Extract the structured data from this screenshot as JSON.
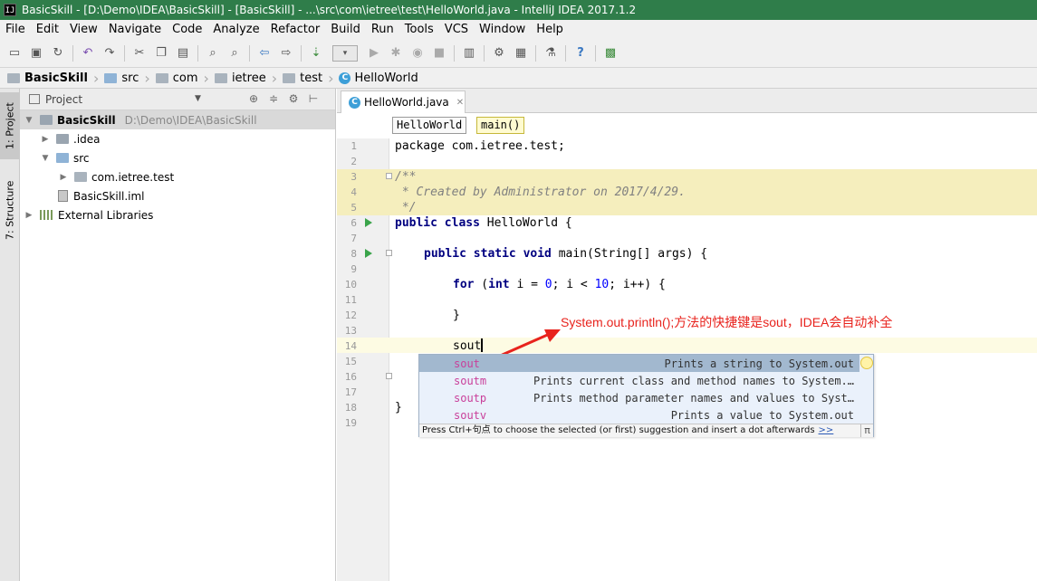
{
  "window": {
    "title": "BasicSkill - [D:\\Demo\\IDEA\\BasicSkill] - [BasicSkill] - ...\\src\\com\\ietree\\test\\HelloWorld.java - IntelliJ IDEA 2017.1.2",
    "app_icon": "IJ"
  },
  "menu": [
    "File",
    "Edit",
    "View",
    "Navigate",
    "Code",
    "Analyze",
    "Refactor",
    "Build",
    "Run",
    "Tools",
    "VCS",
    "Window",
    "Help"
  ],
  "breadcrumb": [
    "BasicSkill",
    "src",
    "com",
    "ietree",
    "test",
    "HelloWorld"
  ],
  "tool_strip": {
    "project_tab": "1: Project",
    "structure_tab": "7: Structure"
  },
  "project_panel": {
    "title": "Project",
    "tree": [
      {
        "label": "BasicSkill",
        "path": "D:\\Demo\\IDEA\\BasicSkill"
      },
      {
        "label": ".idea"
      },
      {
        "label": "src"
      },
      {
        "label": "com.ietree.test"
      },
      {
        "label": "BasicSkill.iml"
      },
      {
        "label": "External Libraries"
      }
    ]
  },
  "editor": {
    "tab": "HelloWorld.java",
    "crumbs": [
      "HelloWorld",
      "main()"
    ],
    "line_numbers": [
      "1",
      "2",
      "3",
      "4",
      "5",
      "6",
      "7",
      "8",
      "9",
      "10",
      "11",
      "12",
      "13",
      "14",
      "15",
      "16",
      "17",
      "18",
      "19"
    ],
    "lines": {
      "l1": "package com.ietree.test;",
      "l3": "/**",
      "l4": " * Created by Administrator on 2017/4/29.",
      "l5": " */",
      "l6_kw": "public class",
      "l6_rest": " HelloWorld {",
      "l8_kw": "public static void",
      "l8_rest": " main(String[] args) {",
      "l10_kw": "for",
      "l10_a": " (",
      "l10_int": "int",
      "l10_b": " i = ",
      "l10_n0": "0",
      "l10_c": "; i < ",
      "l10_n10": "10",
      "l10_d": "; i++) {",
      "l12": "}",
      "l14": "sout",
      "l18": "}"
    }
  },
  "annotation": "System.out.println();方法的快捷键是sout，IDEA会自动补全",
  "completion": {
    "items": [
      {
        "name": "sout",
        "desc": "Prints a string to System.out"
      },
      {
        "name": "soutm",
        "desc": "Prints current class and method names to System.…"
      },
      {
        "name": "soutp",
        "desc": "Prints method parameter names and values to Syst…"
      },
      {
        "name": "soutv",
        "desc": "Prints a value to System.out"
      }
    ],
    "footer": "Press Ctrl+句点 to choose the selected (or first) suggestion and insert a dot afterwards",
    "footer_link": ">>",
    "pi": "π"
  },
  "colors": {
    "title_bar": "#2f7d4a",
    "annotation": "#e8231d",
    "keyword": "#000080",
    "number": "#0000ff",
    "comment": "#808080",
    "live_template": "#c93f9a"
  }
}
